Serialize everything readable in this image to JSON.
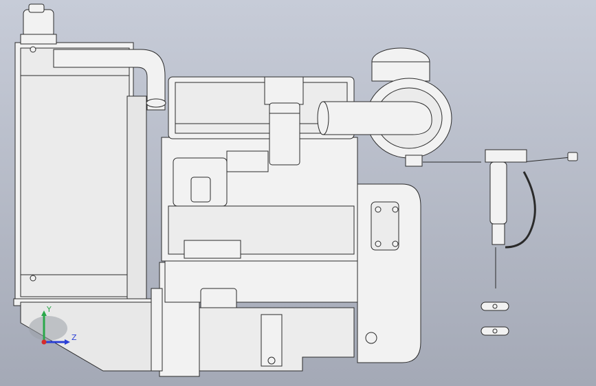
{
  "viewport": {
    "background_top": "#c7ccd8",
    "background_bottom": "#a4a9b6",
    "model_fill": "#f2f2f2",
    "model_stroke": "#2a2a2a"
  },
  "triad": {
    "y_label": "Y",
    "z_label": "Z",
    "y_color": "#2aa84a",
    "z_color": "#2b3fd6",
    "x_color": "#d62b2b"
  },
  "model": {
    "parts": [
      "radiator",
      "coolant-header-tank",
      "upper-coolant-hose",
      "engine-block",
      "valve-cover",
      "fuel-filter",
      "fuel-injection-pump",
      "oil-filter",
      "oil-sump",
      "flywheel-housing",
      "air-cleaner",
      "intake-pipe",
      "front-mounting-bracket",
      "fuel-water-separator",
      "fuel-line",
      "hose-clamps"
    ]
  }
}
